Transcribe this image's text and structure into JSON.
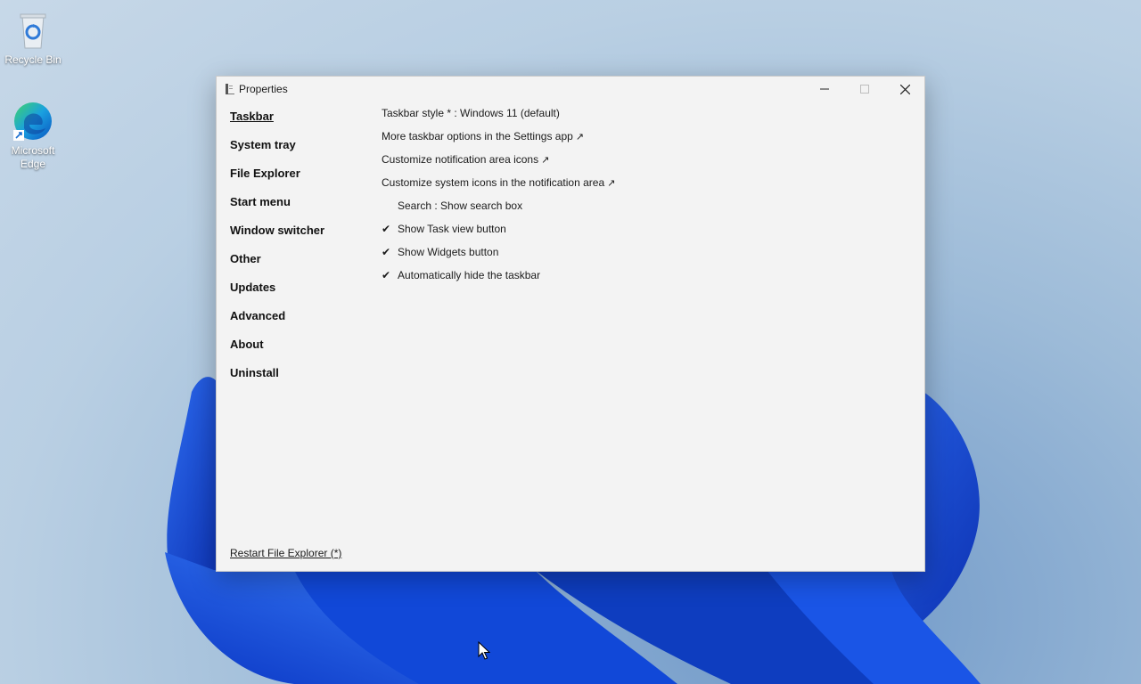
{
  "desktop": {
    "icons": [
      {
        "label": "Recycle Bin",
        "icon": "recycle-bin-icon"
      },
      {
        "label": "Microsoft Edge",
        "icon": "edge-icon"
      }
    ]
  },
  "window": {
    "title": "Properties",
    "controls": {
      "minimize": "minimize-icon",
      "maximize": "maximize-icon",
      "close": "close-icon"
    }
  },
  "nav": {
    "items": [
      {
        "label": "Taskbar",
        "active": true
      },
      {
        "label": "System tray"
      },
      {
        "label": "File Explorer"
      },
      {
        "label": "Start menu"
      },
      {
        "label": "Window switcher"
      },
      {
        "label": "Other"
      },
      {
        "label": "Updates"
      },
      {
        "label": "Advanced"
      },
      {
        "label": "About"
      },
      {
        "label": "Uninstall"
      }
    ]
  },
  "settings": {
    "taskbar_style": "Taskbar style * : Windows 11 (default)",
    "more_options": "More taskbar options in the Settings app",
    "notification_icons": "Customize notification area icons",
    "system_icons": "Customize system icons in the notification area",
    "external_arrow": "↗",
    "search": "Search : Show search box",
    "task_view": "Show Task view button",
    "widgets": "Show Widgets button",
    "auto_hide": "Automatically hide the taskbar",
    "check_mark": "✔"
  },
  "footer": {
    "restart_label": "Restart File Explorer (*)"
  }
}
